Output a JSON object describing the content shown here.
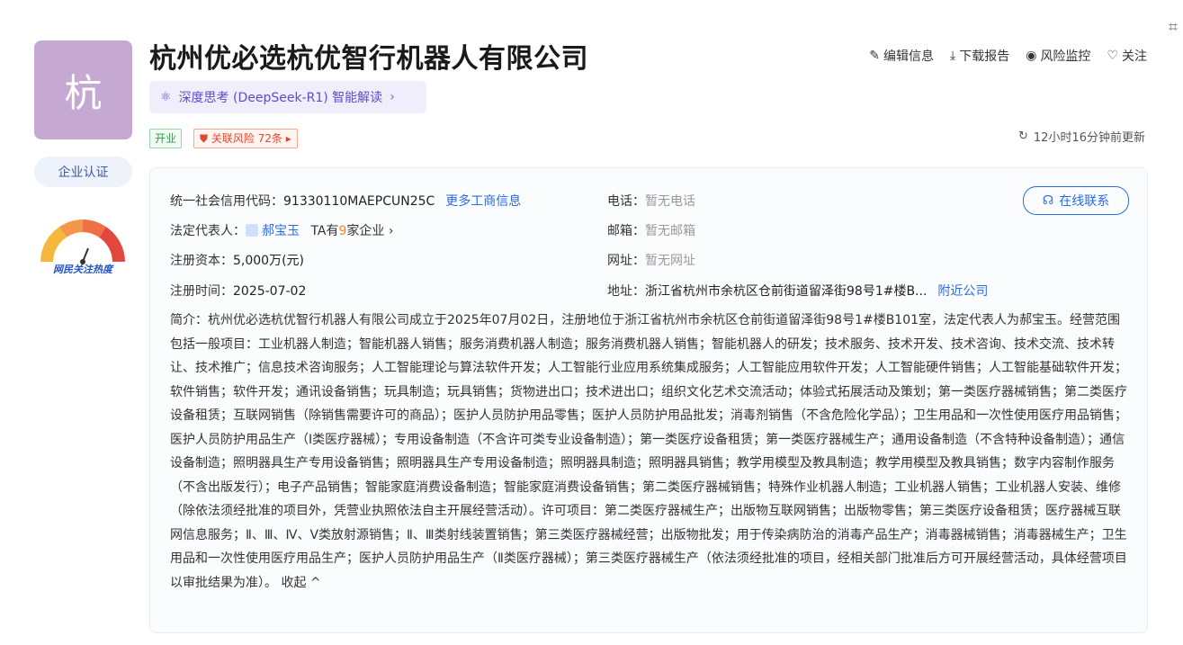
{
  "company": {
    "logo_char": "杭",
    "name": "杭州优必选杭优智行机器人有限公司",
    "cert_label": "企业认证",
    "heat_label": "网民关注热度",
    "ai_label": "深度思考 (DeepSeek-R1) 智能解读",
    "status_tag": "开业",
    "risk_tag": "关联风险 72条"
  },
  "actions": {
    "edit": "编辑信息",
    "download": "下载报告",
    "monitor": "风险监控",
    "follow": "关注"
  },
  "update_text": "12小时16分钟前更新",
  "details": {
    "credit_label": "统一社会信用代码：",
    "credit_value": "91330110MAEPCUN25C",
    "more_info_link": "更多工商信息",
    "legal_label": "法定代表人：",
    "legal_value": "郝宝玉",
    "legal_extra_prefix": "TA有",
    "legal_extra_count": "9",
    "legal_extra_suffix": "家企业 ›",
    "capital_label": "注册资本：",
    "capital_value": "5,000万(元)",
    "regdate_label": "注册时间：",
    "regdate_value": "2025-07-02",
    "phone_label": "电话：",
    "phone_value": "暂无电话",
    "email_label": "邮箱：",
    "email_value": "暂无邮箱",
    "website_label": "网址：",
    "website_value": "暂无网址",
    "address_label": "地址：",
    "address_value": "浙江省杭州市余杭区仓前街道留泽街98号1#楼B...",
    "nearby_link": "附近公司",
    "online_contact": "在线联系"
  },
  "summary": {
    "text": "简介：杭州优必选杭优智行机器人有限公司成立于2025年07月02日，注册地位于浙江省杭州市余杭区仓前街道留泽街98号1#楼B101室，法定代表人为郝宝玉。经营范围包括一般项目：工业机器人制造；智能机器人销售；服务消费机器人制造；服务消费机器人销售；智能机器人的研发；技术服务、技术开发、技术咨询、技术交流、技术转让、技术推广；信息技术咨询服务；人工智能理论与算法软件开发；人工智能行业应用系统集成服务；人工智能应用软件开发；人工智能硬件销售；人工智能基础软件开发；软件销售；软件开发；通讯设备销售；玩具制造；玩具销售；货物进出口；技术进出口；组织文化艺术交流活动；体验式拓展活动及策划；第一类医疗器械销售；第二类医疗设备租赁；互联网销售（除销售需要许可的商品）；医护人员防护用品零售；医护人员防护用品批发；消毒剂销售（不含危险化学品）；卫生用品和一次性使用医疗用品销售；医护人员防护用品生产（Ⅰ类医疗器械）；专用设备制造（不含许可类专业设备制造）；第一类医疗设备租赁；第一类医疗器械生产；通用设备制造（不含特种设备制造）；通信设备制造；照明器具生产专用设备销售；照明器具生产专用设备制造；照明器具制造；照明器具销售；教学用模型及教具制造；教学用模型及教具销售；数字内容制作服务（不含出版发行）；电子产品销售；智能家庭消费设备制造；智能家庭消费设备销售；第二类医疗器械销售；特殊作业机器人制造；工业机器人销售；工业机器人安装、维修（除依法须经批准的项目外，凭营业执照依法自主开展经营活动）。许可项目：第二类医疗器械生产；出版物互联网销售；出版物零售；第三类医疗设备租赁；医疗器械互联网信息服务；Ⅱ、Ⅲ、Ⅳ、Ⅴ类放射源销售；Ⅱ、Ⅲ类射线装置销售；第三类医疗器械经营；出版物批发；用于传染病防治的消毒产品生产；消毒器械销售；消毒器械生产；卫生用品和一次性使用医疗用品生产；医护人员防护用品生产（Ⅱ类医疗器械）；第三类医疗器械生产（依法须经批准的项目，经相关部门批准后方可开展经营活动，具体经营项目以审批结果为准）。",
    "collapse_label": "收起 ^"
  },
  "colors": {
    "accent": "#2b6be0",
    "logo_bg": "#c5a9d2",
    "risk": "#e0482c",
    "open": "#2f9d4f"
  }
}
